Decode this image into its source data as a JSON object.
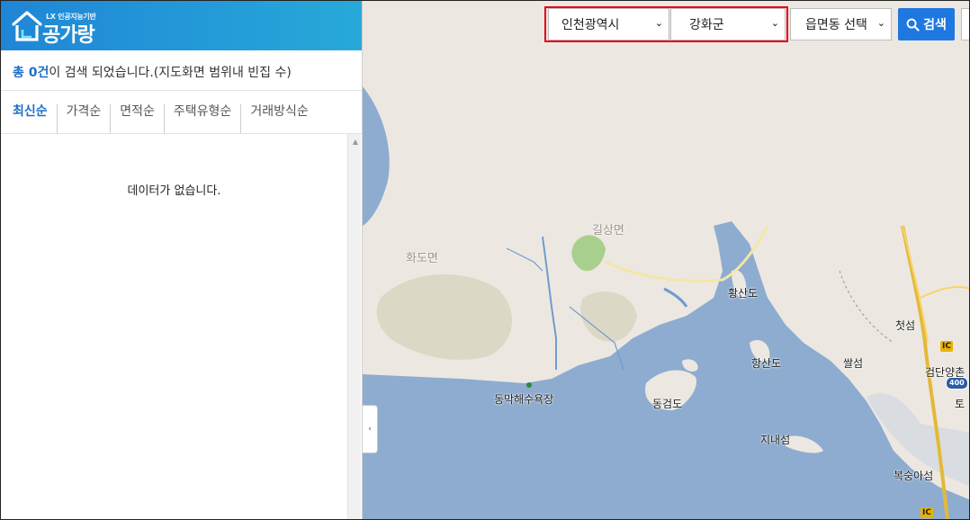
{
  "brand": {
    "name": "공가랑",
    "sub": "LX 인공지능기반"
  },
  "summary": {
    "prefix": "총 ",
    "count": "0건",
    "suffix": "이 검색 되었습니다.(지도화면 범위내 빈집 수)"
  },
  "sort_tabs": [
    {
      "label": "최신순",
      "active": true
    },
    {
      "label": "가격순",
      "active": false
    },
    {
      "label": "면적순",
      "active": false
    },
    {
      "label": "주택유형순",
      "active": false
    },
    {
      "label": "거래방식순",
      "active": false
    }
  ],
  "list": {
    "empty_message": "데이터가 없습니다."
  },
  "search": {
    "sido": "인천광역시",
    "sigungu": "강화군",
    "eupmyeondong": "읍면동 선택",
    "button_label": "검색"
  },
  "map": {
    "labels": {
      "hwado": "화도면",
      "gilsang": "길상면",
      "hwangsando1": "황산도",
      "hwangsando2": "항산도",
      "dongmak": "동막해수욕장",
      "donggeomdo": "동검도",
      "jinaeseom": "지내섬",
      "cheotseom": "첫섬",
      "ssalseom": "쌀섬",
      "geomdan": "검단양촌",
      "to": "토",
      "boksung": "복숭아섬"
    },
    "ic_label": "IC",
    "route_number": "400",
    "collapse_glyph": "‹"
  },
  "colors": {
    "accent": "#1f6fc5",
    "header_gradient_start": "#1f86d6",
    "header_gradient_end": "#27a9d9",
    "highlight": "#e60012",
    "sea": "#8eaccf",
    "land": "#ece8e1"
  }
}
